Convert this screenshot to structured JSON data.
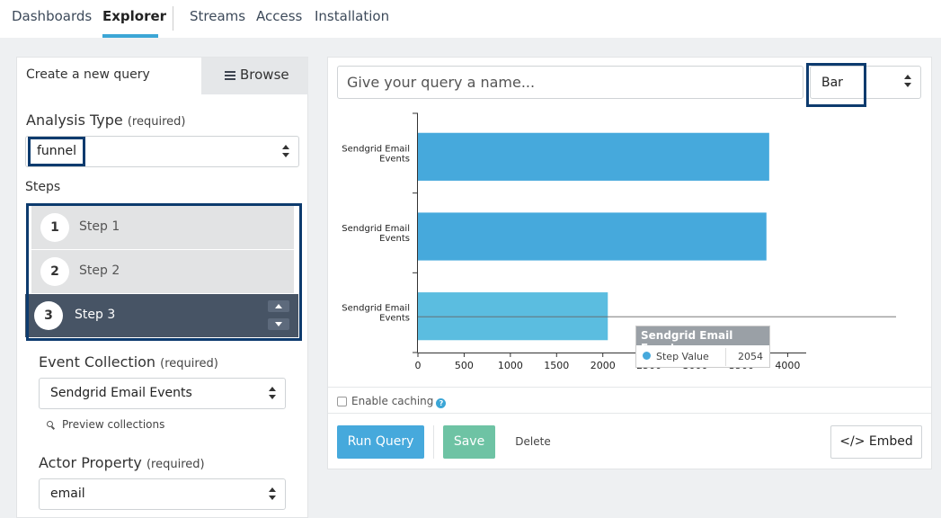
{
  "nav": {
    "items": [
      "Dashboards",
      "Explorer",
      "Streams",
      "Access",
      "Installation"
    ],
    "active": "Explorer"
  },
  "tabs": {
    "create": "Create a new query",
    "browse": "Browse"
  },
  "analysis_type": {
    "label": "Analysis Type",
    "required": "(required)",
    "value": "funnel"
  },
  "steps": {
    "label": "Steps",
    "items": [
      {
        "number": "1",
        "label": "Step 1"
      },
      {
        "number": "2",
        "label": "Step 2"
      },
      {
        "number": "3",
        "label": "Step 3"
      }
    ],
    "active_index": 2
  },
  "event_collection": {
    "label": "Event Collection",
    "required": "(required)",
    "value": "Sendgrid Email Events",
    "preview_link": "Preview collections"
  },
  "actor_property": {
    "label": "Actor Property",
    "required": "(required)",
    "value": "email"
  },
  "query": {
    "name_placeholder": "Give your query a name...",
    "chart_type": "Bar"
  },
  "chart_data": {
    "type": "bar",
    "orientation": "horizontal",
    "categories": [
      "Sendgrid Email Events",
      "Sendgrid Email Events",
      "Sendgrid Email Events"
    ],
    "values": [
      3800,
      3770,
      2054
    ],
    "xticks": [
      0,
      500,
      1000,
      1500,
      2000,
      2500,
      3000,
      3500,
      4000
    ],
    "xlim": [
      0,
      4200
    ],
    "bar_color": "#46a9dc",
    "hover_bar_color": "#5bbde0",
    "tooltip": {
      "title": "Sendgrid Email Events",
      "key": "Step Value",
      "value": "2054"
    }
  },
  "options": {
    "enable_caching": "Enable caching",
    "help": "?"
  },
  "actions": {
    "run": "Run Query",
    "save": "Save",
    "delete": "Delete",
    "embed": "</> Embed"
  }
}
